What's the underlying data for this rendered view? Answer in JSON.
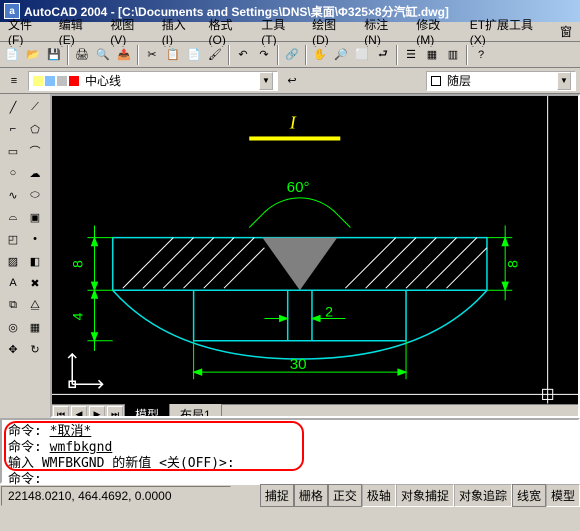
{
  "window": {
    "app_name": "AutoCAD 2004",
    "doc_path": "[C:\\Documents and Settings\\DNS\\桌面\\Φ325×8分汽缸.dwg]"
  },
  "menu": {
    "file": "文件(F)",
    "edit": "编辑(E)",
    "view": "视图(V)",
    "insert": "插入(I)",
    "format": "格式(O)",
    "tools": "工具(T)",
    "draw": "绘图(D)",
    "dimension": "标注(N)",
    "modify": "修改(M)",
    "et_tools": "ET扩展工具(X)",
    "window": "窗"
  },
  "layer": {
    "current_name": "中心线",
    "bylayer": "随层"
  },
  "tabs": {
    "model": "模型",
    "layout1": "布局1"
  },
  "command": {
    "l1a": "命令:  ",
    "l1b": "*取消*",
    "l2a": "命令:  ",
    "l2b": "wmfbkgnd",
    "l3": "输入 WMFBKGND 的新值 <关(OFF)>:",
    "l4": "命令:"
  },
  "status": {
    "coords": "22148.0210, 464.4692, 0.0000",
    "snap": "捕捉",
    "grid": "栅格",
    "ortho": "正交",
    "polar": "极轴",
    "osnap": "对象捕捉",
    "otrack": "对象追踪",
    "lwt": "线宽",
    "model": "模型"
  },
  "drawing": {
    "angle_label": "60°",
    "dim_left_top": "8",
    "dim_left_bottom": "4",
    "dim_right": "8",
    "dim_slot": "2",
    "dim_width": "30",
    "top_symbol": "I"
  }
}
